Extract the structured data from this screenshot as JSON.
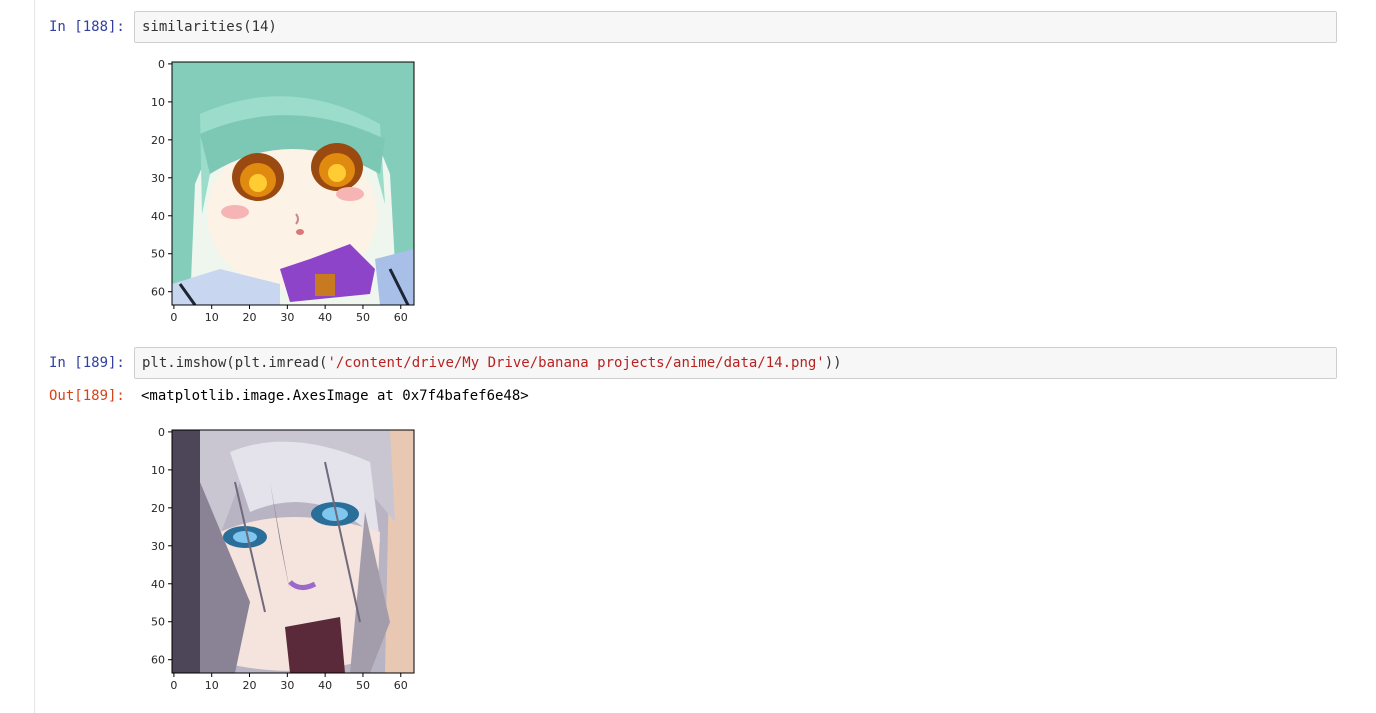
{
  "cells": [
    {
      "in_prompt": "In [188]:",
      "code_plain": "similarities(14)",
      "plot": {
        "art": "green-hair",
        "y_ticks": [
          "0",
          "10",
          "20",
          "30",
          "40",
          "50",
          "60"
        ],
        "x_ticks": [
          "0",
          "10",
          "20",
          "30",
          "40",
          "50",
          "60"
        ]
      }
    },
    {
      "in_prompt": "In [189]:",
      "code_prefix": "plt.imshow(plt.imread(",
      "code_string": "'/content/drive/My Drive/banana projects/anime/data/14.png'",
      "code_suffix": "))",
      "out_prompt": "Out[189]:",
      "out_text": "<matplotlib.image.AxesImage at 0x7f4bafef6e48>",
      "plot": {
        "art": "silver-hair",
        "y_ticks": [
          "0",
          "10",
          "20",
          "30",
          "40",
          "50",
          "60"
        ],
        "x_ticks": [
          "0",
          "10",
          "20",
          "30",
          "40",
          "50",
          "60"
        ]
      }
    }
  ]
}
